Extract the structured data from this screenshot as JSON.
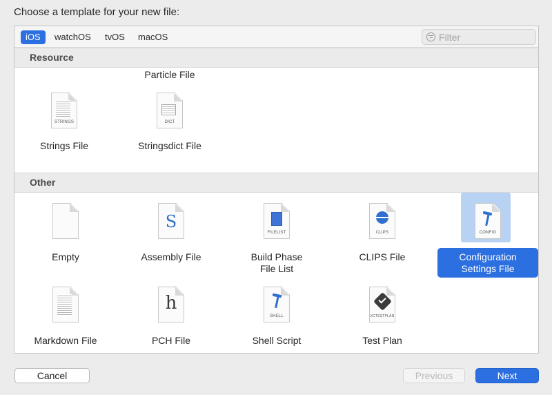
{
  "dialog": {
    "title": "Choose a template for your new file:"
  },
  "platforms": {
    "tabs": [
      {
        "label": "iOS",
        "selected": true
      },
      {
        "label": "watchOS",
        "selected": false
      },
      {
        "label": "tvOS",
        "selected": false
      },
      {
        "label": "macOS",
        "selected": false
      }
    ]
  },
  "filter": {
    "placeholder": "Filter",
    "value": ""
  },
  "sections": {
    "resource": {
      "title": "Resource",
      "items": [
        {
          "label": "Particle File",
          "icon": "particle-file-icon"
        },
        {
          "label": "Strings File",
          "icon": "strings-file-icon",
          "badge": "STRINGS"
        },
        {
          "label": "Stringsdict File",
          "icon": "stringsdict-file-icon",
          "badge": "DICT"
        }
      ]
    },
    "other": {
      "title": "Other",
      "items": [
        {
          "label": "Empty",
          "icon": "empty-file-icon"
        },
        {
          "label": "Assembly File",
          "icon": "assembly-file-icon",
          "glyph": "S"
        },
        {
          "label_line1": "Build Phase",
          "label_line2": "File List",
          "icon": "build-phase-file-list-icon",
          "badge": "FILELIST"
        },
        {
          "label": "CLIPS File",
          "icon": "clips-file-icon",
          "badge": "CLIPS"
        },
        {
          "label_line1": "Configuration",
          "label_line2": "Settings File",
          "icon": "config-file-icon",
          "badge": "CONFIG",
          "selected": true
        },
        {
          "label": "Markdown File",
          "icon": "markdown-file-icon"
        },
        {
          "label": "PCH File",
          "icon": "pch-file-icon",
          "glyph": "h"
        },
        {
          "label": "Shell Script",
          "icon": "shell-script-icon",
          "badge": "SHELL"
        },
        {
          "label": "Test Plan",
          "icon": "test-plan-icon",
          "badge": "XCTESTPLAN"
        }
      ]
    }
  },
  "buttons": {
    "cancel": "Cancel",
    "previous": "Previous",
    "next": "Next"
  },
  "colors": {
    "accent": "#2b6fe0",
    "selection_highlight": "#b8d2f3"
  }
}
